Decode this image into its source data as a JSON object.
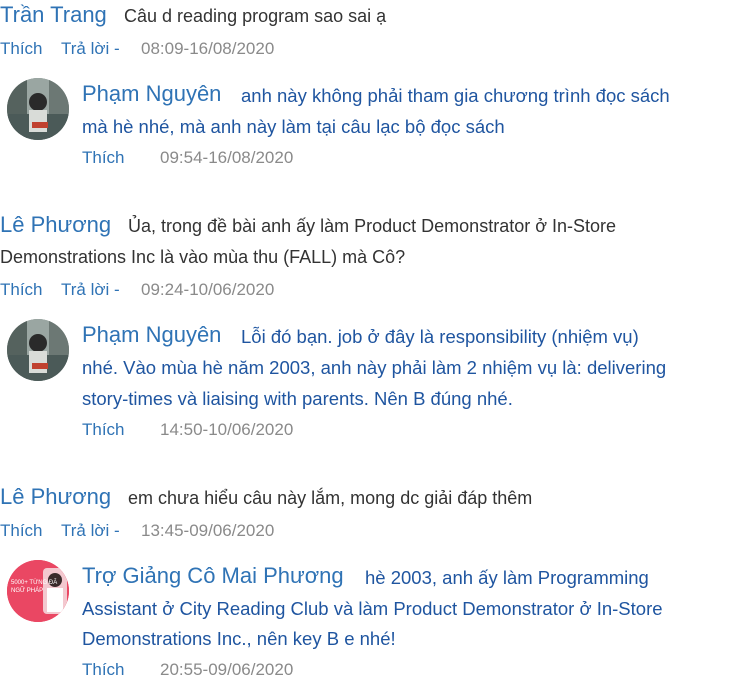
{
  "comments": [
    {
      "author": "Trần Trang",
      "text": "Câu d reading program sao sai ạ",
      "like": "Thích",
      "reply": "Trả lời -",
      "time": "08:09-16/08/2020",
      "replies": [
        {
          "author": "Phạm Nguyên",
          "lines": [
            "anh này không phải tham gia chương trình đọc sách",
            "mà hè nhé, mà anh này làm tại câu lạc bộ đọc sách"
          ],
          "like": "Thích",
          "time": "09:54-16/08/2020"
        }
      ]
    },
    {
      "author": "Lê Phương",
      "lines": [
        "Ủa, trong đề bài anh ấy làm Product Demonstrator ở In-Store",
        "Demonstrations Inc là vào mùa thu (FALL) mà Cô?"
      ],
      "like": "Thích",
      "reply": "Trả lời -",
      "time": "09:24-10/06/2020",
      "replies": [
        {
          "author": "Phạm Nguyên",
          "lines": [
            "Lỗi đó bạn. job ở đây là responsibility (nhiệm vụ)",
            "nhé. Vào mùa hè năm 2003, anh này phải làm 2 nhiệm vụ là: delivering",
            "story-times và liaising with parents. Nên B đúng nhé."
          ],
          "like": "Thích",
          "time": "14:50-10/06/2020"
        }
      ]
    },
    {
      "author": "Lê Phương",
      "text": "em chưa hiểu câu này lắm, mong dc giải đáp thêm",
      "like": "Thích",
      "reply": "Trả lời -",
      "time": "13:45-09/06/2020",
      "replies": [
        {
          "author": "Trợ Giảng Cô Mai Phương",
          "lines": [
            "hè 2003, anh ấy làm Programming",
            "Assistant ở City Reading Club và làm Product Demonstrator ở In-Store",
            "Demonstrations Inc., nên key B e nhé!"
          ],
          "like": "Thích",
          "time": "20:55-09/06/2020"
        }
      ]
    }
  ],
  "avatar_badge": "5000+ TỪNG ĐÃ NGỮ PHÁP"
}
